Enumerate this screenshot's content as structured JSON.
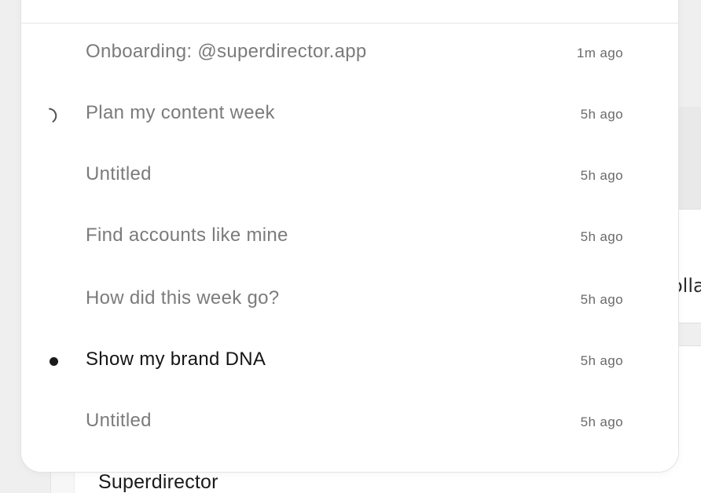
{
  "background": {
    "peek_text": "olla",
    "brand_name": "Superdirector"
  },
  "conversations": [
    {
      "title": "Onboarding: @superdirector.app",
      "time": "1m ago",
      "indicator": "none"
    },
    {
      "title": "Plan my content week",
      "time": "5h ago",
      "indicator": "spinner"
    },
    {
      "title": "Untitled",
      "time": "5h ago",
      "indicator": "none"
    },
    {
      "title": "Find accounts like mine",
      "time": "5h ago",
      "indicator": "none"
    },
    {
      "title": "How did this week go?",
      "time": "5h ago",
      "indicator": "none"
    },
    {
      "title": "Show my brand DNA",
      "time": "5h ago",
      "indicator": "active-dot"
    },
    {
      "title": "Untitled",
      "time": "5h ago",
      "indicator": "none"
    }
  ],
  "colors": {
    "inactive_text": "#7b7b7b",
    "active_text": "#151515",
    "time_text": "#6a6a6a"
  }
}
